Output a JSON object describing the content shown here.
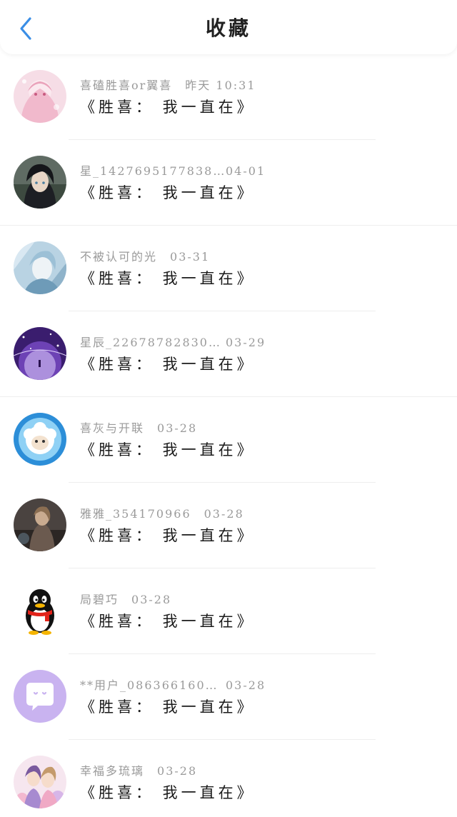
{
  "header": {
    "title": "收藏",
    "back_icon": "chevron-left-icon",
    "accent_color": "#3a8ee6"
  },
  "items": [
    {
      "name": "喜磕胜喜or翼喜",
      "time": "昨天 10:31",
      "message": "《胜喜： 我一直在》",
      "avatar": "pink-anime-avatar"
    },
    {
      "name": "星_1427695177838…",
      "time": "04-01",
      "message": "《胜喜： 我一直在》",
      "avatar": "dark-hair-anime-avatar"
    },
    {
      "name": "不被认可的光",
      "time": "03-31",
      "message": "《胜喜： 我一直在》",
      "avatar": "blue-anime-avatar"
    },
    {
      "name": "星辰_22678782830…",
      "time": "03-29",
      "message": "《胜喜： 我一直在》",
      "avatar": "purple-galaxy-avatar"
    },
    {
      "name": "喜灰与开联",
      "time": "03-28",
      "message": "《胜喜： 我一直在》",
      "avatar": "sheep-cartoon-avatar"
    },
    {
      "name": "雅雅_354170966",
      "time": "03-28",
      "message": "《胜喜： 我一直在》",
      "avatar": "painting-avatar"
    },
    {
      "name": "局碧巧",
      "time": "03-28",
      "message": "《胜喜： 我一直在》",
      "avatar": "qq-penguin-avatar"
    },
    {
      "name": "**用户_086366160…",
      "time": "03-28",
      "message": "《胜喜： 我一直在》",
      "avatar": "purple-chat-avatar"
    },
    {
      "name": "幸福多琉璃",
      "time": "03-28",
      "message": "《胜喜： 我一直在》",
      "avatar": "floral-anime-avatar"
    }
  ]
}
